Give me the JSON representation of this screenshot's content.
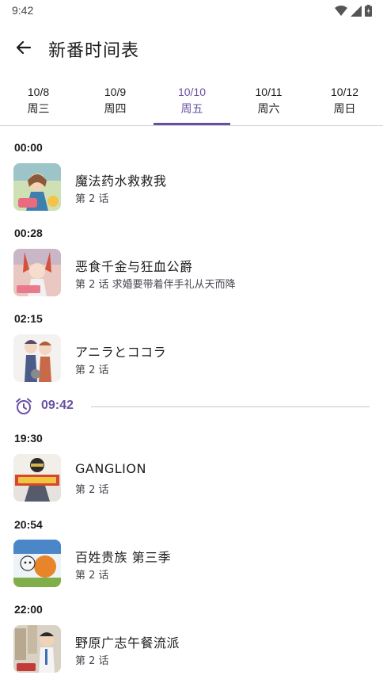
{
  "status": {
    "time": "9:42"
  },
  "app_bar": {
    "title": "新番时间表"
  },
  "tabs": [
    {
      "date": "10/8",
      "weekday": "周三"
    },
    {
      "date": "10/9",
      "weekday": "周四"
    },
    {
      "date": "10/10",
      "weekday": "周五"
    },
    {
      "date": "10/11",
      "weekday": "周六"
    },
    {
      "date": "10/12",
      "weekday": "周日"
    }
  ],
  "selected_tab": "10/10",
  "accent_color": "#6750a4",
  "now_marker": {
    "time": "09:42",
    "icon": "alarm-clock-icon"
  },
  "schedule": [
    {
      "time": "00:00",
      "title": "魔法药水救救我",
      "episode": "第 2 话"
    },
    {
      "time": "00:28",
      "title": "恶食千金与狂血公爵",
      "episode": "第 2 话  求婚要带着伴手礼从天而降"
    },
    {
      "time": "02:15",
      "title": "アニラとココラ",
      "episode": "第 2 话"
    },
    {
      "time": "19:30",
      "title": "GANGLION",
      "episode": "第 2 话"
    },
    {
      "time": "20:54",
      "title": "百姓贵族 第三季",
      "episode": "第 2 话"
    },
    {
      "time": "22:00",
      "title": "野原广志午餐流派",
      "episode": "第 2 话"
    }
  ]
}
